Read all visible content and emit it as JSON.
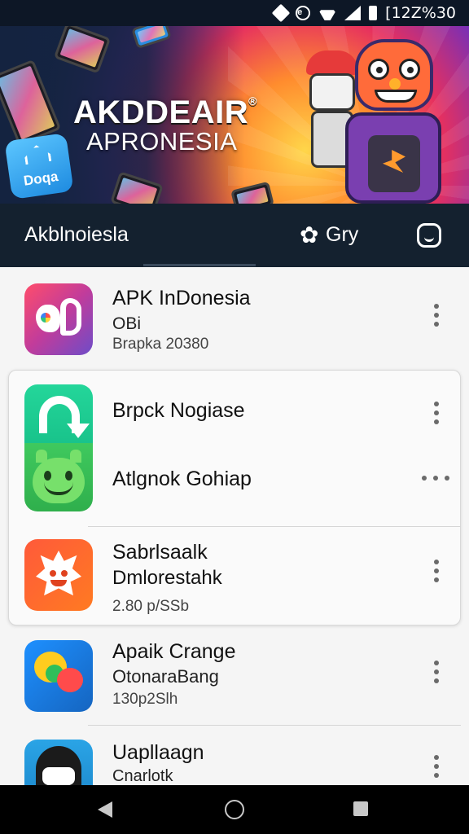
{
  "status_bar": {
    "time": "[12Z%30"
  },
  "banner": {
    "title": "AKDDEAIR",
    "title_mark": "®",
    "subtitle": "APRONESIA",
    "logo_text": "Doqa"
  },
  "app_bar": {
    "title": "Akblnoiesla",
    "category_label": "Gry"
  },
  "apps": [
    {
      "name": "APK InDonesia",
      "sub": "OBi",
      "meta": "Brapka 20380"
    },
    {
      "name": "Brpck Nogiase"
    },
    {
      "name": "Atlgnok Gohiap"
    },
    {
      "name": "Sabrlsaalk",
      "sub": "Dmlorestahk",
      "meta": "2.80 p/SSb"
    },
    {
      "name": "Apaik Crange",
      "sub": "OtonaraBang",
      "meta": "130p2Slh"
    },
    {
      "name": "Uapllaagn",
      "sub": "Cnarlotk"
    }
  ],
  "colors": {
    "app_bar_bg": "#14212f",
    "status_bar_bg": "#0d1726",
    "list_bg": "#f5f5f5",
    "nav_bar_bg": "#000000"
  }
}
